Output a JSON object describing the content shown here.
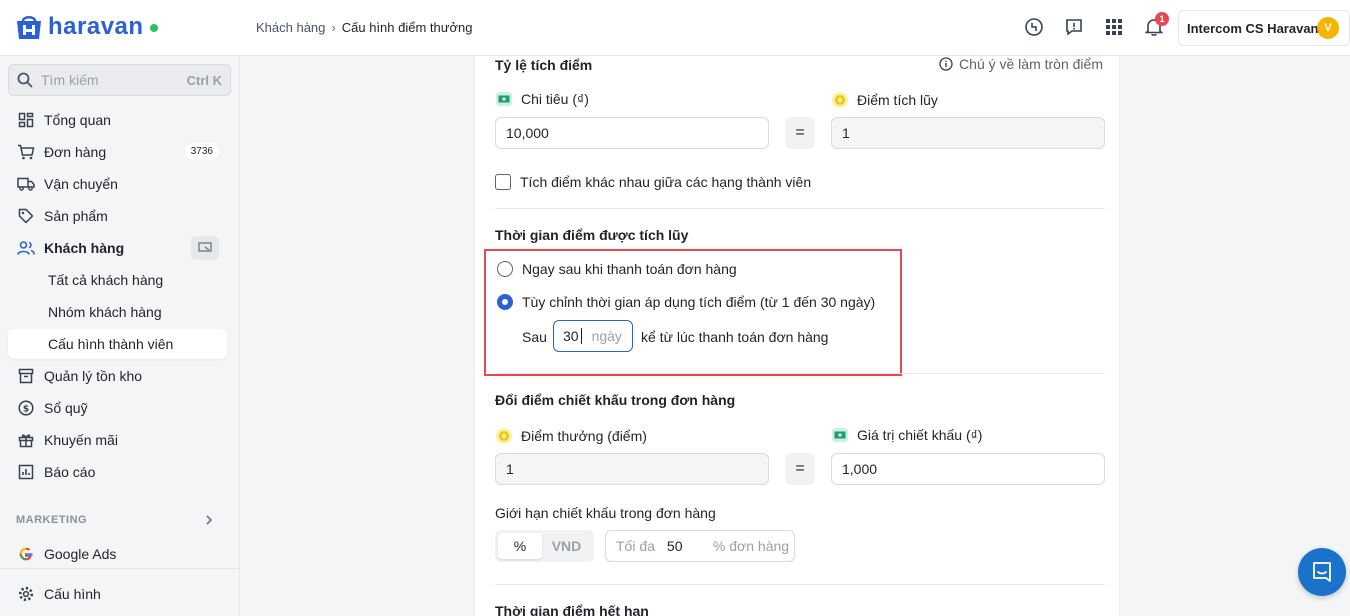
{
  "brand": {
    "name": "haravan",
    "color": "#2a62d6"
  },
  "breadcrumb": {
    "parent": "Khách hàng",
    "current": "Cấu hình điểm thưởng"
  },
  "header": {
    "notification_count": "1",
    "account_name": "Intercom CS Haravan",
    "avatar_letter": "V"
  },
  "sidebar": {
    "search_placeholder": "Tìm kiếm",
    "search_shortcut": "Ctrl K",
    "items": [
      {
        "label": "Tổng quan",
        "icon": "dashboard-icon"
      },
      {
        "label": "Đơn hàng",
        "icon": "cart-icon",
        "badge": "3736"
      },
      {
        "label": "Vận chuyển",
        "icon": "truck-icon"
      },
      {
        "label": "Sản phẩm",
        "icon": "tag-icon"
      },
      {
        "label": "Khách hàng",
        "icon": "users-icon"
      },
      {
        "label": "Tất cả khách hàng"
      },
      {
        "label": "Nhóm khách hàng"
      },
      {
        "label": "Cấu hình thành viên"
      },
      {
        "label": "Quản lý tồn kho",
        "icon": "archive-icon"
      },
      {
        "label": "Sổ quỹ",
        "icon": "dollar-icon"
      },
      {
        "label": "Khuyến mãi",
        "icon": "gift-icon"
      },
      {
        "label": "Báo cáo",
        "icon": "chart-icon"
      }
    ],
    "marketing_label": "MARKETING",
    "google_ads": "Google Ads",
    "settings": "Cấu hình"
  },
  "accrual": {
    "title": "Tỷ lệ tích điểm",
    "note": "Chú ý về làm tròn điểm",
    "spend_label": "Chi tiêu (₫)",
    "points_label": "Điểm tích lũy",
    "spend_value": "10,000",
    "points_value": "1",
    "equals": "=",
    "tier_checkbox_label": "Tích điểm khác nhau giữa các hạng thành viên"
  },
  "accrual_time": {
    "title": "Thời gian điểm được tích lũy",
    "option_immediate": "Ngay sau khi thanh toán đơn hàng",
    "option_custom": "Tùy chỉnh thời gian áp dụng tích điểm (từ 1 đến 30 ngày)",
    "after_label": "Sau",
    "days_value": "30",
    "days_unit": "ngày",
    "after_suffix": "kể từ lúc thanh toán đơn hàng"
  },
  "redeem": {
    "title": "Đổi điểm chiết khấu trong đơn hàng",
    "points_label": "Điểm thưởng (điểm)",
    "discount_label": "Giá trị chiết khấu (₫)",
    "points_value": "1",
    "discount_value": "1,000",
    "equals": "=",
    "limit_title": "Giới hạn chiết khấu trong đơn hàng",
    "seg_percent": "%",
    "seg_vnd": "VND",
    "limit_prefix": "Tối đa",
    "limit_value": "50",
    "limit_suffix": "% đơn hàng"
  },
  "expiry": {
    "title": "Thời gian điểm hết hạn"
  }
}
